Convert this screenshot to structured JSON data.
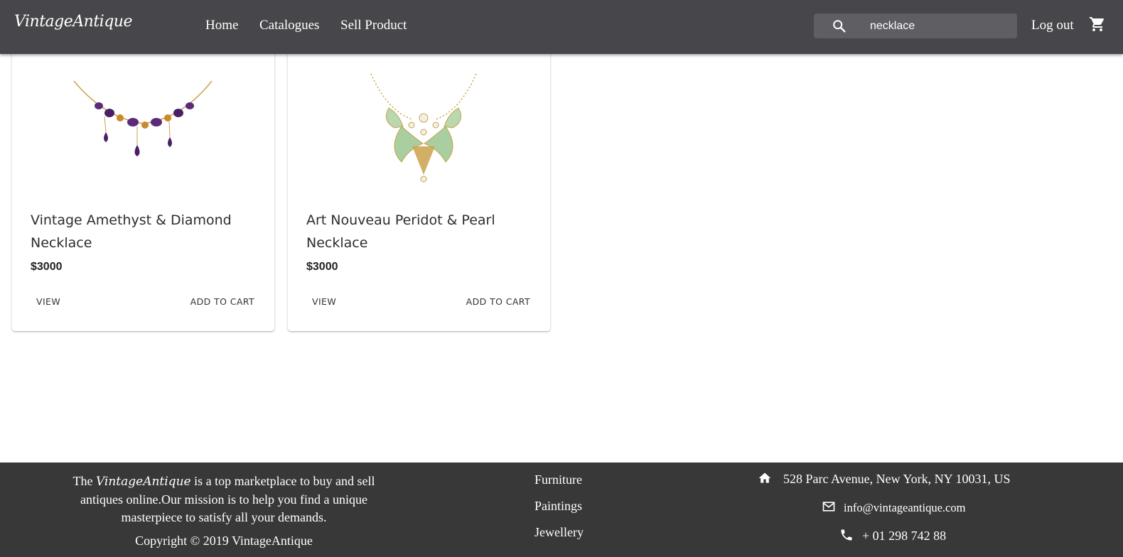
{
  "header": {
    "logo": "VintageAntique",
    "nav": [
      "Home",
      "Catalogues",
      "Sell Product"
    ],
    "search_value": "necklace",
    "logout_label": "Log out"
  },
  "products": [
    {
      "title_line1": "Vintage Amethyst & Diamond",
      "title_line2": "Necklace",
      "price": "$3000",
      "view_label": "VIEW",
      "add_label": "ADD TO CART"
    },
    {
      "title_line1": "Art Nouveau Peridot & Pearl",
      "title_line2": "Necklace",
      "price": "$3000",
      "view_label": "VIEW",
      "add_label": "ADD TO CART"
    }
  ],
  "footer": {
    "about_pre": "The",
    "about_brand": "VintageAntique",
    "about_post": "is a top marketplace to buy and sell antiques online.Our mission is to help you find a unique masterpiece to satisfy all your demands.",
    "copyright": "Copyright © 2019 VintageAntique",
    "categories": [
      "Furniture",
      "Paintings",
      "Jewellery"
    ],
    "address": "528 Parc Avenue, New York, NY 10031, US",
    "email": "info@vintageantique.com",
    "phone": "+ 01 298 742 88"
  },
  "icons": [
    "search-icon",
    "cart-icon",
    "home-icon",
    "mail-icon",
    "phone-icon"
  ],
  "colors": {
    "appbar": "#47474b",
    "search_bg": "#5e5e63",
    "footer": "#383838",
    "amethyst": "#5b2a78",
    "gold": "#c9a24a",
    "peridot": "#b9d8b0"
  }
}
